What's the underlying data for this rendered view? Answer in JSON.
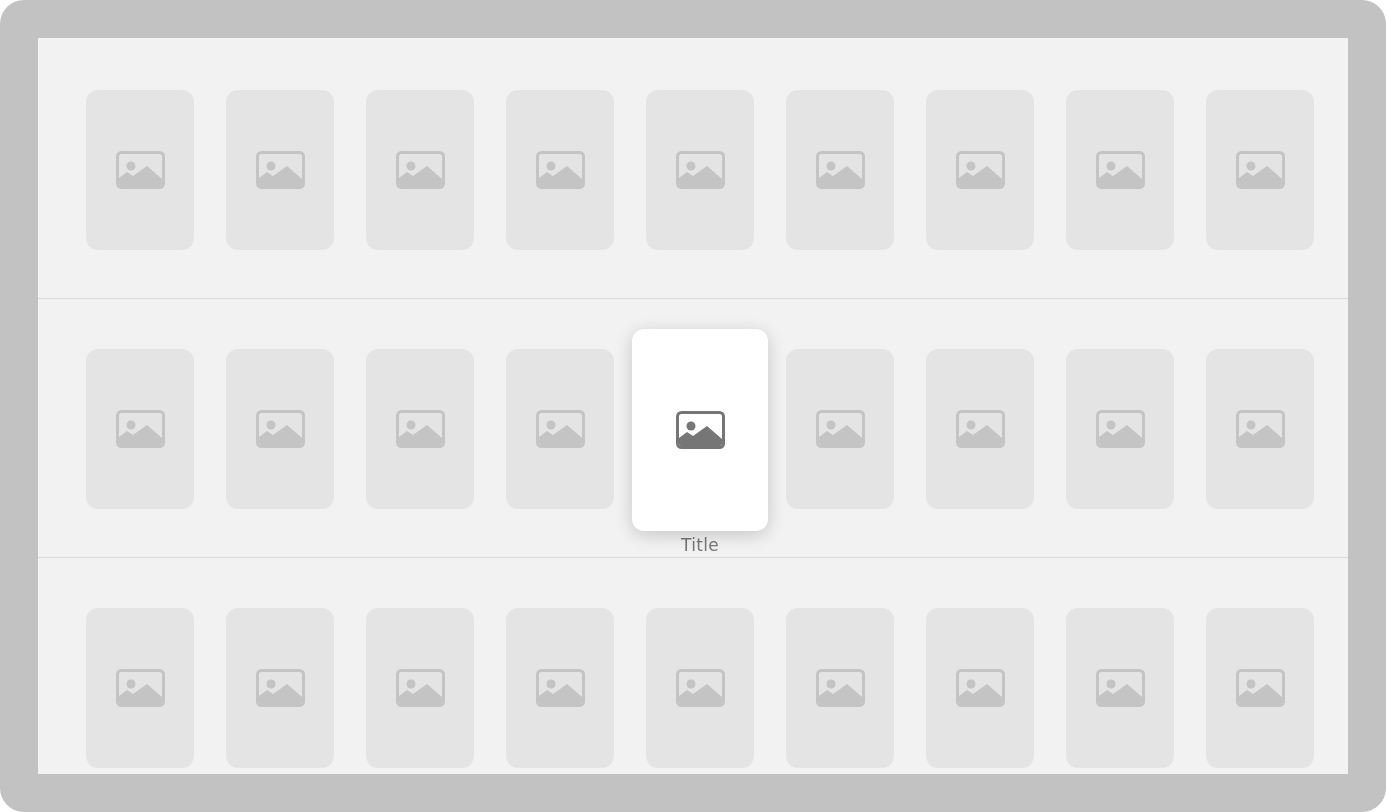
{
  "rows": [
    {
      "cards": [
        {
          "selected": false
        },
        {
          "selected": false
        },
        {
          "selected": false
        },
        {
          "selected": false
        },
        {
          "selected": false
        },
        {
          "selected": false
        },
        {
          "selected": false
        },
        {
          "selected": false
        },
        {
          "selected": false
        }
      ]
    },
    {
      "cards": [
        {
          "selected": false
        },
        {
          "selected": false
        },
        {
          "selected": false
        },
        {
          "selected": false
        },
        {
          "selected": true,
          "title": "Title"
        },
        {
          "selected": false
        },
        {
          "selected": false
        },
        {
          "selected": false
        },
        {
          "selected": false
        }
      ]
    },
    {
      "cards": [
        {
          "selected": false
        },
        {
          "selected": false
        },
        {
          "selected": false
        },
        {
          "selected": false
        },
        {
          "selected": false
        },
        {
          "selected": false
        },
        {
          "selected": false
        },
        {
          "selected": false
        },
        {
          "selected": false
        }
      ]
    }
  ]
}
